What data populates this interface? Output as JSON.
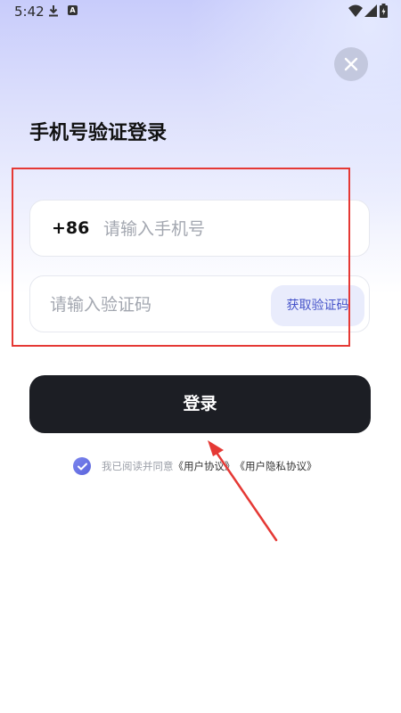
{
  "status_bar": {
    "time": "5:42",
    "icons": [
      "download-icon",
      "a-icon",
      "wifi-icon",
      "signal-icon",
      "battery-icon"
    ]
  },
  "header": {
    "close_icon": "close-icon",
    "title": "手机号验证登录"
  },
  "form": {
    "country_code": "+86",
    "phone_placeholder": "请输入手机号",
    "phone_value": "",
    "code_placeholder": "请输入验证码",
    "code_value": "",
    "get_code_label": "获取验证码"
  },
  "login_button": {
    "label": "登录"
  },
  "agreement": {
    "checked": true,
    "prefix": "我已阅读并同意",
    "user_agreement": "《用户协议》",
    "privacy_agreement": "《用户隐私协议》"
  },
  "colors": {
    "primary_button": "#1c1e24",
    "accent": "#4553c9",
    "highlight": "#e53935"
  }
}
